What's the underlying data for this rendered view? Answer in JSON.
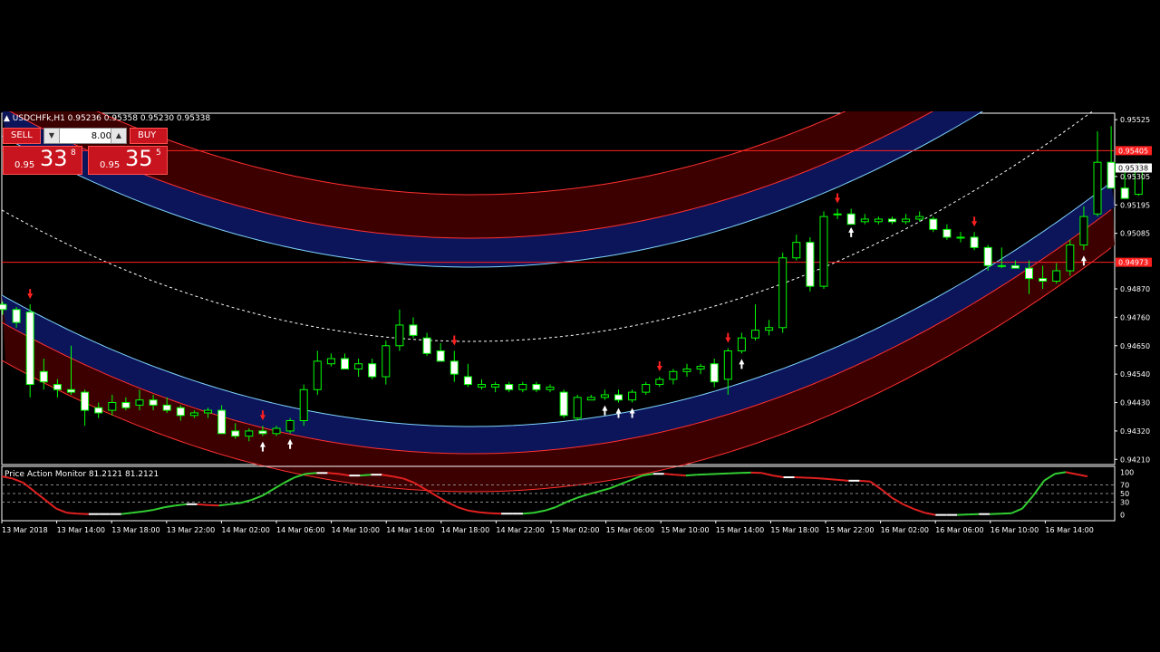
{
  "symbol_header": {
    "text": "USDCHFk,H1  0.95236 0.95358 0.95230 0.95338"
  },
  "trade_panel": {
    "sell_label": "SELL",
    "buy_label": "BUY",
    "lot_value": "8.00",
    "sell_price_prefix": "0.95",
    "sell_price_big": "33",
    "sell_price_sup": "8",
    "buy_price_prefix": "0.95",
    "buy_price_big": "35",
    "buy_price_sup": "5",
    "color": "#c8141e"
  },
  "indicator_title": "Price Action Monitor 81.2121 81.2121",
  "chart_data": {
    "type": "candlestick",
    "symbol": "USDCHFk",
    "timeframe": "H1",
    "ohlc_header": [
      0.95236,
      0.95358,
      0.9523,
      0.95338
    ],
    "y_ticks": [
      "0.95525",
      "0.95305",
      "0.95195",
      "0.95085",
      "0.94870",
      "0.94760",
      "0.94650",
      "0.94540",
      "0.94430",
      "0.94320",
      "0.94210"
    ],
    "ylim": [
      0.9419,
      0.9555
    ],
    "current_price_label": "0.95338",
    "horizontal_lines": [
      {
        "label": "0.95405",
        "value": 0.95405,
        "color": "#ff2020"
      },
      {
        "label": "0.94973",
        "value": 0.94973,
        "color": "#ff2020"
      }
    ],
    "x_labels": [
      "13 Mar 2018",
      "13 Mar 14:00",
      "13 Mar 18:00",
      "13 Mar 22:00",
      "14 Mar 02:00",
      "14 Mar 06:00",
      "14 Mar 10:00",
      "14 Mar 14:00",
      "14 Mar 18:00",
      "14 Mar 22:00",
      "15 Mar 02:00",
      "15 Mar 06:00",
      "15 Mar 10:00",
      "15 Mar 14:00",
      "15 Mar 18:00",
      "15 Mar 22:00",
      "16 Mar 02:00",
      "16 Mar 06:00",
      "16 Mar 10:00",
      "16 Mar 14:00"
    ],
    "candles": [
      [
        0.9481,
        0.9482,
        0.9477,
        0.9479
      ],
      [
        0.9479,
        0.948,
        0.9472,
        0.9474
      ],
      [
        0.9478,
        0.9481,
        0.9445,
        0.945
      ],
      [
        0.9455,
        0.946,
        0.9448,
        0.9451
      ],
      [
        0.945,
        0.9452,
        0.9445,
        0.9448
      ],
      [
        0.9448,
        0.9465,
        0.9446,
        0.9447
      ],
      [
        0.9447,
        0.9448,
        0.9434,
        0.944
      ],
      [
        0.9441,
        0.9443,
        0.9437,
        0.9439
      ],
      [
        0.944,
        0.9446,
        0.9438,
        0.9443
      ],
      [
        0.9443,
        0.9445,
        0.944,
        0.9441
      ],
      [
        0.9442,
        0.9448,
        0.944,
        0.9444
      ],
      [
        0.9444,
        0.9446,
        0.944,
        0.9442
      ],
      [
        0.9442,
        0.9445,
        0.9439,
        0.944
      ],
      [
        0.9441,
        0.9442,
        0.9436,
        0.9438
      ],
      [
        0.9438,
        0.944,
        0.9437,
        0.9439
      ],
      [
        0.9439,
        0.9441,
        0.9437,
        0.944
      ],
      [
        0.944,
        0.9442,
        0.9434,
        0.9431
      ],
      [
        0.9432,
        0.9435,
        0.9429,
        0.943
      ],
      [
        0.943,
        0.9433,
        0.9428,
        0.9432
      ],
      [
        0.9432,
        0.9434,
        0.943,
        0.9431
      ],
      [
        0.9431,
        0.9434,
        0.943,
        0.9433
      ],
      [
        0.9432,
        0.9437,
        0.9431,
        0.9436
      ],
      [
        0.9436,
        0.945,
        0.9434,
        0.9448
      ],
      [
        0.9448,
        0.9463,
        0.9446,
        0.9459
      ],
      [
        0.9458,
        0.9462,
        0.9457,
        0.946
      ],
      [
        0.946,
        0.9462,
        0.9456,
        0.9456
      ],
      [
        0.9456,
        0.946,
        0.9453,
        0.9458
      ],
      [
        0.9458,
        0.946,
        0.9452,
        0.9453
      ],
      [
        0.9453,
        0.9467,
        0.945,
        0.9465
      ],
      [
        0.9465,
        0.9479,
        0.9463,
        0.9473
      ],
      [
        0.9473,
        0.9476,
        0.9468,
        0.9469
      ],
      [
        0.9468,
        0.947,
        0.9461,
        0.9462
      ],
      [
        0.9463,
        0.9466,
        0.9459,
        0.9459
      ],
      [
        0.9459,
        0.9463,
        0.9451,
        0.9454
      ],
      [
        0.9453,
        0.9458,
        0.9449,
        0.945
      ],
      [
        0.9449,
        0.9452,
        0.9448,
        0.945
      ],
      [
        0.9449,
        0.9451,
        0.9447,
        0.945
      ],
      [
        0.945,
        0.9451,
        0.9447,
        0.9448
      ],
      [
        0.9448,
        0.9451,
        0.9447,
        0.945
      ],
      [
        0.945,
        0.9451,
        0.9447,
        0.9448
      ],
      [
        0.9448,
        0.945,
        0.9447,
        0.9449
      ],
      [
        0.9447,
        0.9448,
        0.9437,
        0.9438
      ],
      [
        0.9437,
        0.9446,
        0.9436,
        0.9445
      ],
      [
        0.9444,
        0.9446,
        0.9444,
        0.9445
      ],
      [
        0.9445,
        0.9448,
        0.9444,
        0.9446
      ],
      [
        0.9446,
        0.9448,
        0.9443,
        0.9444
      ],
      [
        0.9444,
        0.9448,
        0.9443,
        0.9447
      ],
      [
        0.9447,
        0.9451,
        0.9446,
        0.945
      ],
      [
        0.945,
        0.9453,
        0.9449,
        0.9452
      ],
      [
        0.9452,
        0.9456,
        0.945,
        0.9455
      ],
      [
        0.9455,
        0.9458,
        0.9453,
        0.9456
      ],
      [
        0.9456,
        0.9458,
        0.9454,
        0.9457
      ],
      [
        0.9458,
        0.946,
        0.9449,
        0.9451
      ],
      [
        0.9452,
        0.9464,
        0.9446,
        0.9463
      ],
      [
        0.9463,
        0.947,
        0.9462,
        0.9468
      ],
      [
        0.9468,
        0.9481,
        0.9467,
        0.9471
      ],
      [
        0.9471,
        0.9475,
        0.9469,
        0.9472
      ],
      [
        0.9472,
        0.9501,
        0.947,
        0.9499
      ],
      [
        0.9499,
        0.9508,
        0.9498,
        0.9505
      ],
      [
        0.9505,
        0.9507,
        0.9486,
        0.9488
      ],
      [
        0.9488,
        0.9517,
        0.9487,
        0.9515
      ],
      [
        0.9516,
        0.9518,
        0.9514,
        0.9516
      ],
      [
        0.9516,
        0.9518,
        0.9513,
        0.9512
      ],
      [
        0.9513,
        0.9516,
        0.9512,
        0.9514
      ],
      [
        0.9513,
        0.9515,
        0.9512,
        0.9514
      ],
      [
        0.9514,
        0.9515,
        0.9512,
        0.9513
      ],
      [
        0.9513,
        0.9516,
        0.9512,
        0.9514
      ],
      [
        0.9514,
        0.9517,
        0.9513,
        0.9515
      ],
      [
        0.9514,
        0.9515,
        0.9509,
        0.951
      ],
      [
        0.951,
        0.9512,
        0.9506,
        0.9507
      ],
      [
        0.9507,
        0.9509,
        0.9505,
        0.9507
      ],
      [
        0.9507,
        0.9509,
        0.9502,
        0.9503
      ],
      [
        0.9503,
        0.9504,
        0.9494,
        0.9496
      ],
      [
        0.9496,
        0.9503,
        0.9495,
        0.9496
      ],
      [
        0.9496,
        0.9498,
        0.9495,
        0.9495
      ],
      [
        0.9495,
        0.9498,
        0.9485,
        0.9491
      ],
      [
        0.9491,
        0.9496,
        0.9487,
        0.949
      ],
      [
        0.949,
        0.9497,
        0.9489,
        0.9494
      ],
      [
        0.9494,
        0.9506,
        0.9492,
        0.9504
      ],
      [
        0.9504,
        0.9519,
        0.9502,
        0.9515
      ],
      [
        0.9516,
        0.9548,
        0.9515,
        0.9536
      ],
      [
        0.9536,
        0.955,
        0.9526,
        0.9526
      ],
      [
        0.9526,
        0.9532,
        0.9522,
        0.9522
      ],
      [
        0.95236,
        0.95358,
        0.9523,
        0.95338
      ]
    ],
    "sell_arrow_indices": [
      2,
      19,
      33,
      48,
      53,
      61,
      71
    ],
    "buy_arrow_indices": [
      19,
      21,
      44,
      45,
      46,
      54,
      62,
      79
    ],
    "band_colors": {
      "outer": "#ff3030",
      "outer_fill": "#3c0000",
      "inner_fill": "#0c145a",
      "center_line": "#7fd4ff",
      "midline": "#ffffff"
    },
    "indicator": {
      "name": "Price Action Monitor",
      "values_shown": [
        81.2121,
        81.2121
      ],
      "y_ticks": [
        "100",
        "70",
        "50",
        "30",
        "0"
      ],
      "levels": [
        70,
        50,
        30
      ],
      "ylim": [
        -5,
        105
      ],
      "series": [
        90,
        85,
        75,
        55,
        35,
        15,
        5,
        3,
        2,
        2,
        2,
        2,
        5,
        8,
        12,
        18,
        22,
        25,
        25,
        23,
        22,
        25,
        28,
        35,
        45,
        60,
        75,
        88,
        96,
        98,
        98,
        96,
        92,
        92,
        94,
        94,
        90,
        85,
        75,
        60,
        45,
        30,
        18,
        10,
        6,
        4,
        3,
        3,
        3,
        5,
        10,
        18,
        30,
        40,
        48,
        55,
        62,
        72,
        82,
        92,
        96,
        96,
        94,
        92,
        94,
        95,
        96,
        97,
        98,
        99,
        98,
        92,
        88,
        88,
        87,
        86,
        84,
        82,
        80,
        80,
        78,
        60,
        40,
        25,
        14,
        5,
        0,
        0,
        0,
        1,
        2,
        2,
        3,
        4,
        15,
        45,
        80,
        96,
        100,
        95,
        90
      ]
    }
  }
}
